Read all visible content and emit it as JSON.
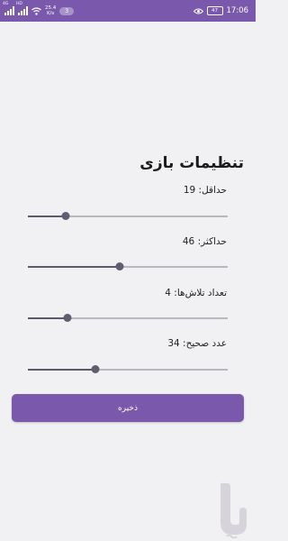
{
  "status_bar": {
    "speed_value": "25.4",
    "speed_unit": "K/s",
    "notification_count": "3",
    "battery": "47",
    "time": "17:06",
    "signal_labels": [
      "4G",
      "HD"
    ]
  },
  "settings": {
    "title": "تنظیمات بازی",
    "min": {
      "label": "حداقل: 19",
      "fraction": 0.19
    },
    "max": {
      "label": "حداکثر: 46",
      "fraction": 0.46
    },
    "attempts": {
      "label": "تعداد تلاش‌ها: 4",
      "fraction": 0.2
    },
    "correct": {
      "label": "عدد صحیح: 34",
      "fraction": 0.34
    }
  },
  "save_label": "ذخیره",
  "colors": {
    "accent": "#7a59ad",
    "thumb": "#5f5d70",
    "background": "#f1f0f2"
  },
  "icons": [
    "signal-icon",
    "wifi-icon",
    "eye-icon",
    "battery-icon",
    "bazaar-logo-icon"
  ]
}
